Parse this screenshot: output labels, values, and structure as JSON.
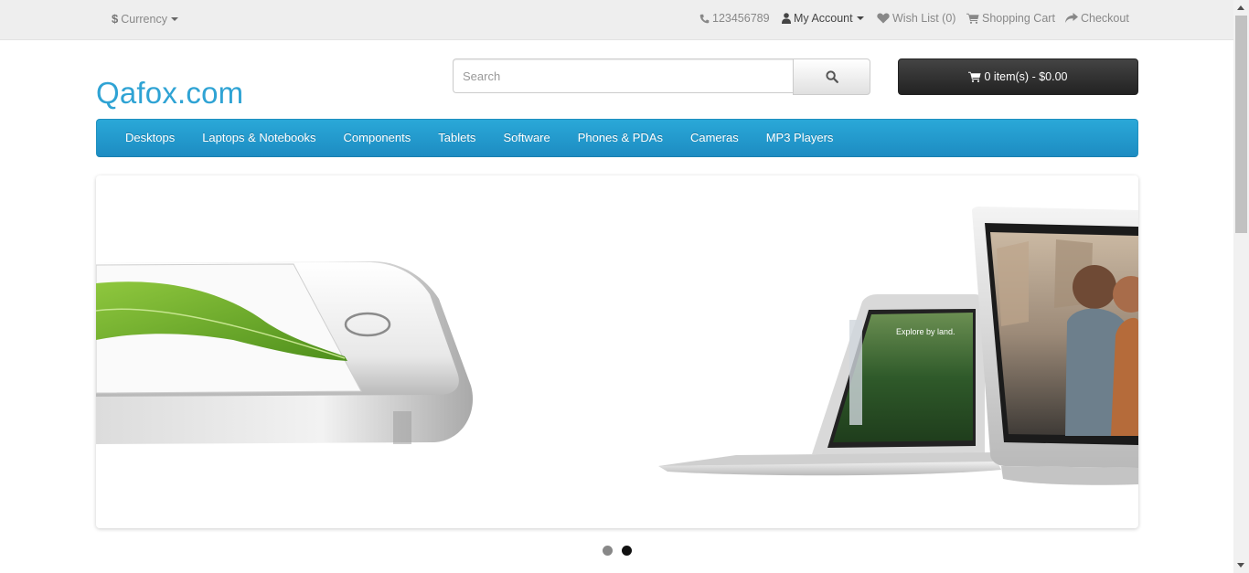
{
  "topbar": {
    "currency_symbol": "$",
    "currency_label": "Currency",
    "phone": "123456789",
    "my_account": "My Account",
    "wishlist": "Wish List (0)",
    "shopping_cart": "Shopping Cart",
    "checkout": "Checkout"
  },
  "header": {
    "logo": "Qafox.com",
    "search_placeholder": "Search",
    "cart_button": "0 item(s) - $0.00"
  },
  "menu": {
    "items": [
      "Desktops",
      "Laptops & Notebooks",
      "Components",
      "Tablets",
      "Software",
      "Phones & PDAs",
      "Cameras",
      "MP3 Players"
    ]
  },
  "slideshow": {
    "laptop_screen_text": "Explore by land.",
    "active_slide": 2,
    "slide_count": 2
  },
  "colors": {
    "accent": "#229ac8",
    "logo": "#2fa3d4",
    "topbar_bg": "#eeeeee",
    "cart_button_bg": "#333333"
  },
  "icons": {
    "phone": "phone-icon",
    "account": "user-icon",
    "wishlist": "heart-icon",
    "cart": "shopping-cart-icon",
    "checkout": "share-arrow-icon",
    "search": "search-icon"
  }
}
